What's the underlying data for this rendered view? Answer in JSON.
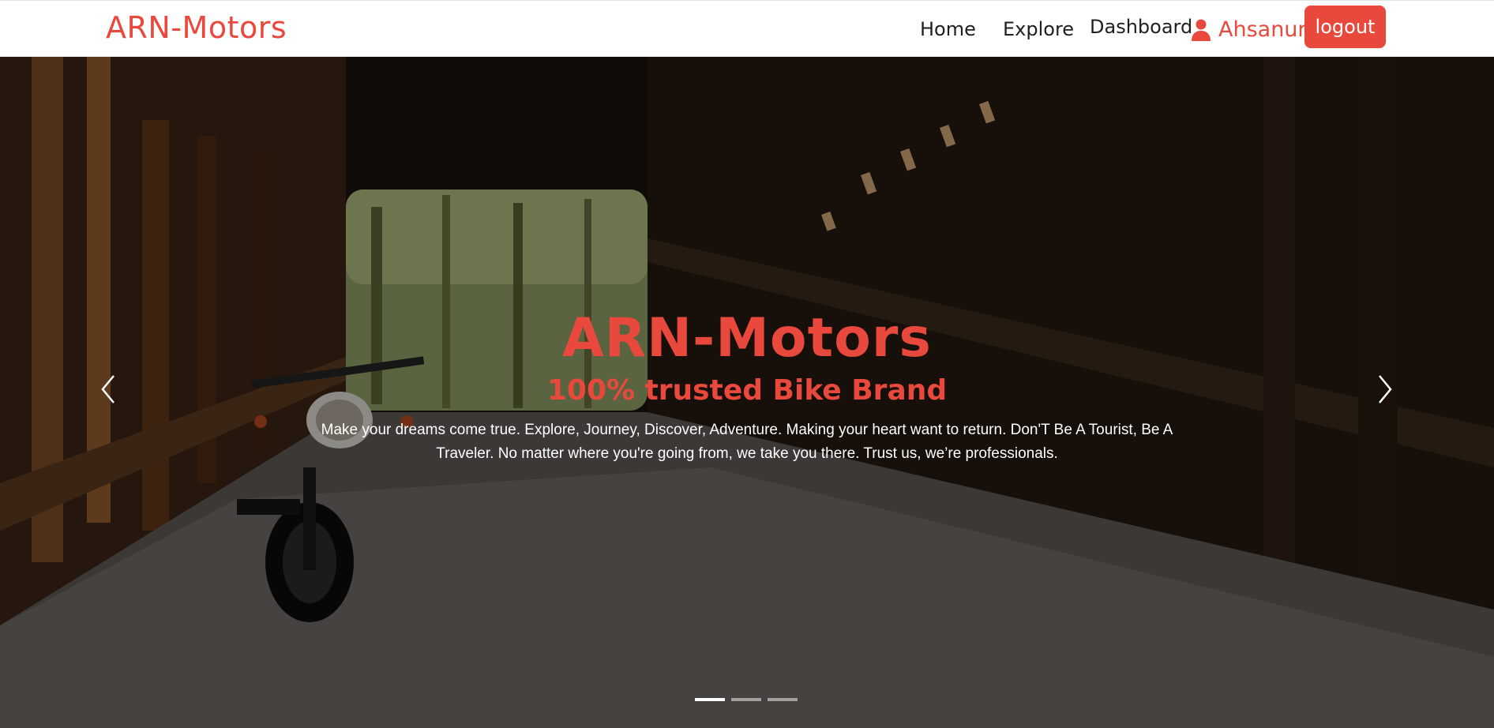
{
  "navbar": {
    "brand": "ARN-Motors",
    "links": [
      "Home",
      "Explore",
      "Dashboard"
    ],
    "user_name": "Ahsanur",
    "logout_label": "logout"
  },
  "hero": {
    "title": "ARN-Motors",
    "subtitle": "100% trusted Bike Brand",
    "text": "Make your dreams come true. Explore, Journey, Discover, Adventure. Making your heart want to return. Don'T Be A Tourist, Be A Traveler. No matter where you're going from, we take you there. Trust us, we’re professionals.",
    "slide_count": 3,
    "active_slide": 1
  },
  "icons": {
    "user": "user-icon",
    "prev": "chevron-left-icon",
    "next": "chevron-right-icon"
  },
  "colors": {
    "accent": "#e9493c",
    "nav_text": "#1f1f1f",
    "hero_overlay": "#000000"
  }
}
